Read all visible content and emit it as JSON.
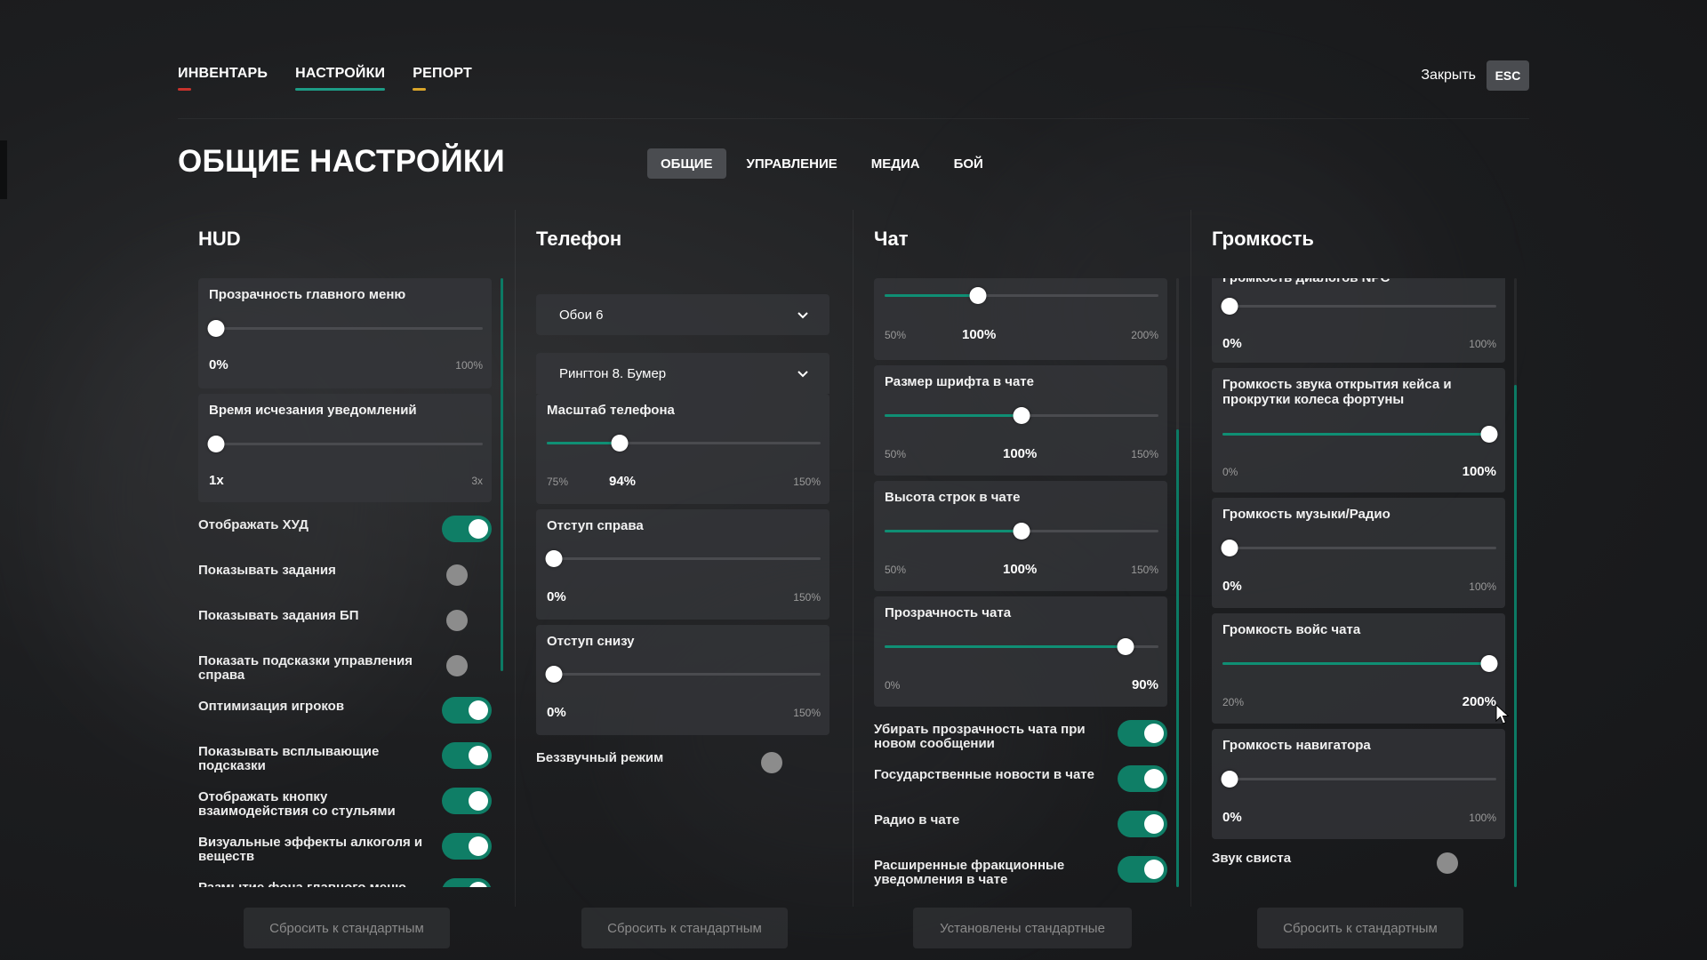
{
  "topnav": [
    {
      "label": "ИНВЕНТАРЬ",
      "accent": "#c8322c"
    },
    {
      "label": "НАСТРОЙКИ",
      "accent": "#1d9c86"
    },
    {
      "label": "РЕПОРТ",
      "accent": "#d9a52a"
    }
  ],
  "close": {
    "label": "Закрыть",
    "key": "ESC"
  },
  "page_title": "ОБЩИЕ НАСТРОЙКИ",
  "subtabs": [
    {
      "label": "ОБЩИЕ",
      "active": true
    },
    {
      "label": "УПРАВЛЕНИЕ",
      "active": false
    },
    {
      "label": "МЕДИА",
      "active": false
    },
    {
      "label": "БОЙ",
      "active": false
    }
  ],
  "colors": {
    "accent_green": "#0f8f74",
    "switch_on": "#0f7e66"
  },
  "hud": {
    "title": "HUD",
    "sliders": [
      {
        "label": "Прозрачность главного меню",
        "min": "0%",
        "max": "100%",
        "value": "0%",
        "fraction": 0
      },
      {
        "label": "Время исчезания уведомлений",
        "min": "1x",
        "max": "3x",
        "value": "1x",
        "fraction": 0
      }
    ],
    "toggles": [
      {
        "label": "Отображать ХУД",
        "on": true
      },
      {
        "label": "Показывать задания",
        "on": false
      },
      {
        "label": "Показывать задания БП",
        "on": false
      },
      {
        "label": "Показать подсказки управления справа",
        "on": false
      },
      {
        "label": "Оптимизация игроков",
        "on": true
      },
      {
        "label": "Показывать всплывающие подсказки",
        "on": true
      },
      {
        "label": "Отображать кнопку взаимодействия со стульями",
        "on": true
      },
      {
        "label": "Визуальные эффекты алкоголя и веществ",
        "on": true
      },
      {
        "label": "Размытие фона главного меню",
        "on": true
      }
    ],
    "reset_label": "Сбросить к стандартным"
  },
  "phone": {
    "title": "Телефон",
    "selects": [
      "Обои 6",
      "Рингтон 8. Бумер"
    ],
    "sliders": [
      {
        "label": "Масштаб телефона",
        "min": "75%",
        "max": "150%",
        "value": "94%",
        "fraction": 0.253
      },
      {
        "label": "Отступ справа",
        "min": "",
        "max": "150%",
        "value": "0%",
        "fraction": 0
      },
      {
        "label": "Отступ снизу",
        "min": "",
        "max": "150%",
        "value": "0%",
        "fraction": 0
      }
    ],
    "toggles": [
      {
        "label": "Беззвучный режим",
        "on": false
      }
    ],
    "reset_label": "Сбросить к стандартным"
  },
  "chat": {
    "title": "Чат",
    "sliders": [
      {
        "label": "",
        "min": "50%",
        "max": "200%",
        "value": "100%",
        "fraction": 0.333
      },
      {
        "label": "Размер шрифта в чате",
        "min": "50%",
        "max": "150%",
        "value": "100%",
        "fraction": 0.5
      },
      {
        "label": "Высота строк в чате",
        "min": "50%",
        "max": "150%",
        "value": "100%",
        "fraction": 0.5
      },
      {
        "label": "Прозрачность чата",
        "min": "0%",
        "max": "",
        "value": "90%",
        "fraction": 0.9
      }
    ],
    "toggles": [
      {
        "label": "Убирать прозрачность чата при новом сообщении",
        "on": true
      },
      {
        "label": "Государственные новости в чате",
        "on": true
      },
      {
        "label": "Радио в чате",
        "on": true
      },
      {
        "label": "Расширенные фракционные уведомления в чате",
        "on": true
      }
    ],
    "reset_label": "Установлены стандартные"
  },
  "volume": {
    "title": "Громкость",
    "sliders": [
      {
        "label": "Громкость диалогов NPC",
        "min": "",
        "max": "100%",
        "value": "0%",
        "fraction": 0
      },
      {
        "label": "Громкость звука открытия кейса и прокрутки колеса фортуны",
        "min": "0%",
        "max": "",
        "value": "100%",
        "fraction": 1
      },
      {
        "label": "Громкость музыки/Радио",
        "min": "",
        "max": "100%",
        "value": "0%",
        "fraction": 0
      },
      {
        "label": "Громкость войс чата",
        "min": "20%",
        "max": "",
        "value": "200%",
        "fraction": 1
      },
      {
        "label": "Громкость навигатора",
        "min": "",
        "max": "100%",
        "value": "0%",
        "fraction": 0
      }
    ],
    "toggles": [
      {
        "label": "Звук свиста",
        "on": false
      }
    ],
    "reset_label": "Сбросить к стандартным"
  }
}
